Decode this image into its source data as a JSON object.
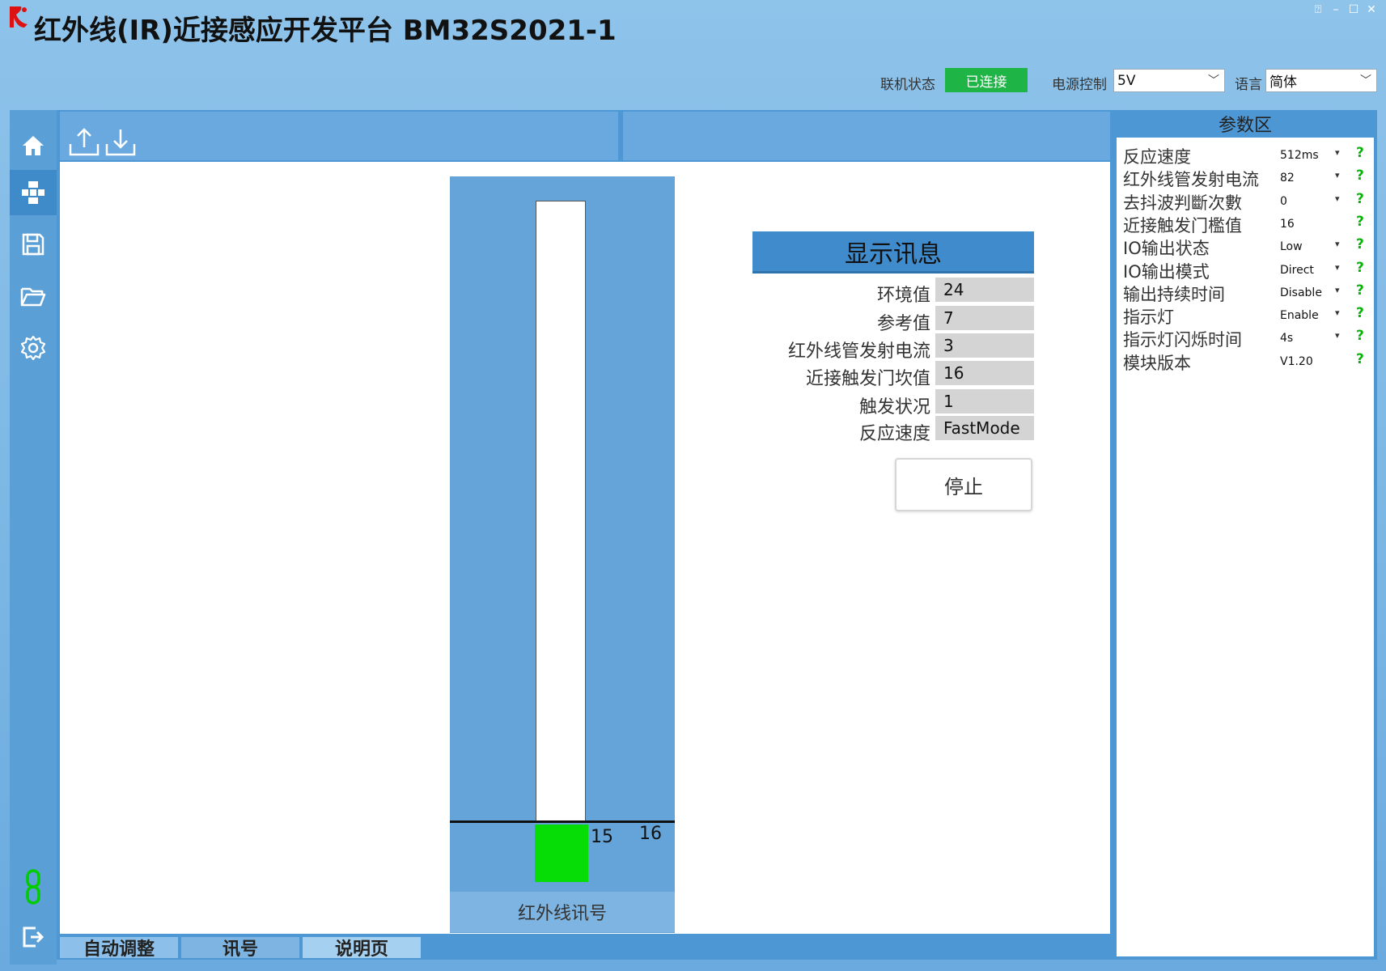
{
  "app": {
    "title": "红外线(IR)近接感应开发平台 BM32S2021-1"
  },
  "status": {
    "conn_label": "联机状态",
    "conn_value": "已连接",
    "power_label": "电源控制",
    "power_value": "5V",
    "lang_label": "语言",
    "lang_value": "简体"
  },
  "gauge": {
    "current_value": "15",
    "threshold_value": "16",
    "caption": "红外线讯号"
  },
  "info": {
    "header": "显示讯息",
    "rows": [
      {
        "label": "环境值",
        "value": "24"
      },
      {
        "label": "参考值",
        "value": "7"
      },
      {
        "label": "红外线管发射电流",
        "value": "3"
      },
      {
        "label": "近接触发门坎值",
        "value": "16"
      },
      {
        "label": "触发状况",
        "value": "1"
      },
      {
        "label": "反应速度",
        "value": "FastMode"
      }
    ],
    "stop_label": "停止"
  },
  "tabs": [
    "自动调整",
    "讯号",
    "说明页"
  ],
  "params": {
    "title": "参数区",
    "rows": [
      {
        "label": "反应速度",
        "value": "512ms",
        "dropdown": true
      },
      {
        "label": "红外线管发射电流",
        "value": "82",
        "dropdown": true
      },
      {
        "label": "去抖波判斷次數",
        "value": "0",
        "dropdown": true
      },
      {
        "label": "近接触发门檻值",
        "value": "16",
        "dropdown": false
      },
      {
        "label": "IO输出状态",
        "value": "Low",
        "dropdown": true
      },
      {
        "label": "IO输出模式",
        "value": "Direct",
        "dropdown": true
      },
      {
        "label": "输出持续时间",
        "value": "Disable",
        "dropdown": true
      },
      {
        "label": "指示灯",
        "value": "Enable",
        "dropdown": true
      },
      {
        "label": "指示灯闪烁时间",
        "value": "4s",
        "dropdown": true
      },
      {
        "label": "模块版本",
        "value": "V1.20",
        "dropdown": false
      }
    ]
  },
  "colors": {
    "accent": "#3f8bcb",
    "connected": "#1fb446",
    "signal": "#06dc06",
    "help": "#07b507"
  },
  "icons": {
    "nav": [
      "home-icon",
      "module-icon",
      "save-icon",
      "folder-open-icon",
      "gear-icon"
    ],
    "bottom": [
      "link-icon",
      "exit-icon"
    ],
    "toolbar": [
      "upload-icon",
      "download-icon"
    ]
  }
}
